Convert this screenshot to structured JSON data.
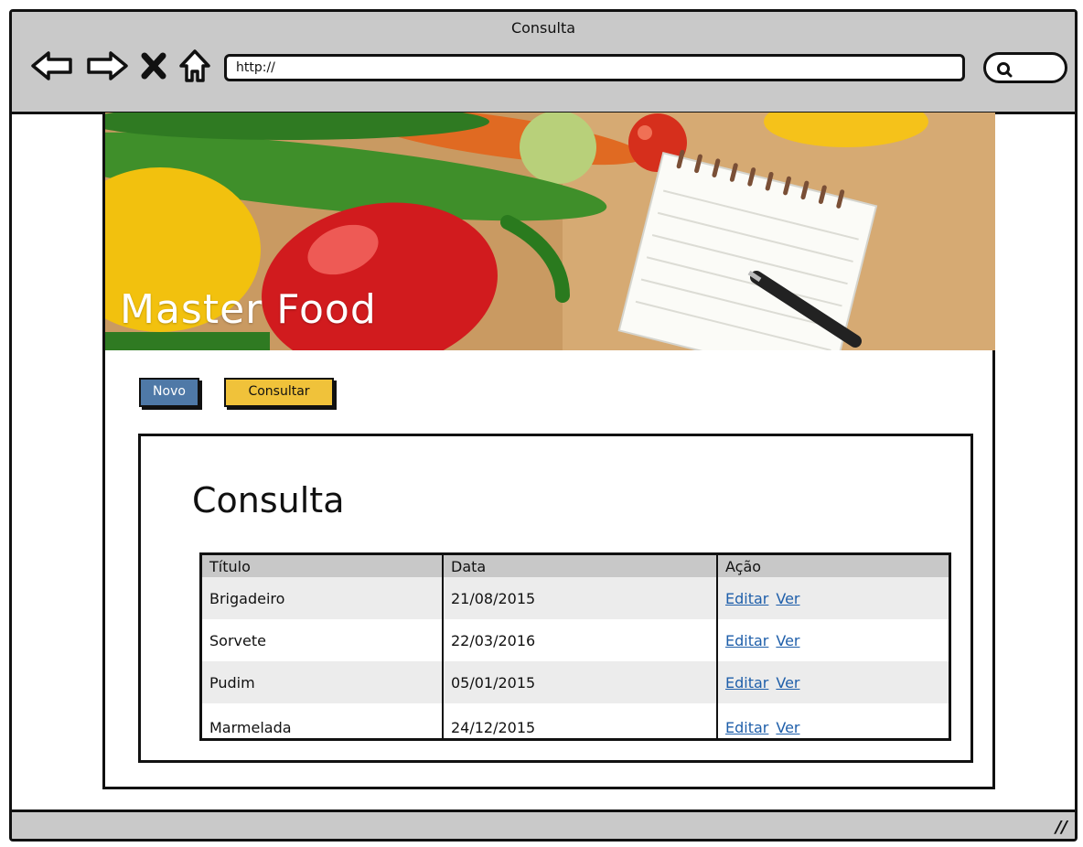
{
  "window": {
    "title": "Consulta"
  },
  "browser": {
    "url": "http://"
  },
  "banner": {
    "title": "Master Food"
  },
  "buttons": {
    "novo": "Novo",
    "consultar": "Consultar"
  },
  "page": {
    "heading": "Consulta"
  },
  "table": {
    "headers": [
      "Título",
      "Data",
      "Ação"
    ],
    "rows": [
      {
        "titulo": "Brigadeiro",
        "data": "21/08/2015",
        "edit": "Editar",
        "view": "Ver"
      },
      {
        "titulo": "Sorvete",
        "data": "22/03/2016",
        "edit": "Editar",
        "view": "Ver"
      },
      {
        "titulo": "Pudim",
        "data": "05/01/2015",
        "edit": "Editar",
        "view": "Ver"
      },
      {
        "titulo": "Marmelada",
        "data": "24/12/2015",
        "edit": "Editar",
        "view": "Ver"
      }
    ]
  },
  "colors": {
    "chrome": "#c9c9c9",
    "novo": "#4f79a7",
    "consultar": "#f0c23a",
    "link": "#1f5faa",
    "row_alt": "#ececec",
    "header": "#c8c8c8"
  },
  "icons": [
    "back-arrow-icon",
    "forward-arrow-icon",
    "stop-icon",
    "home-icon",
    "search-icon",
    "resize-grip-icon"
  ]
}
